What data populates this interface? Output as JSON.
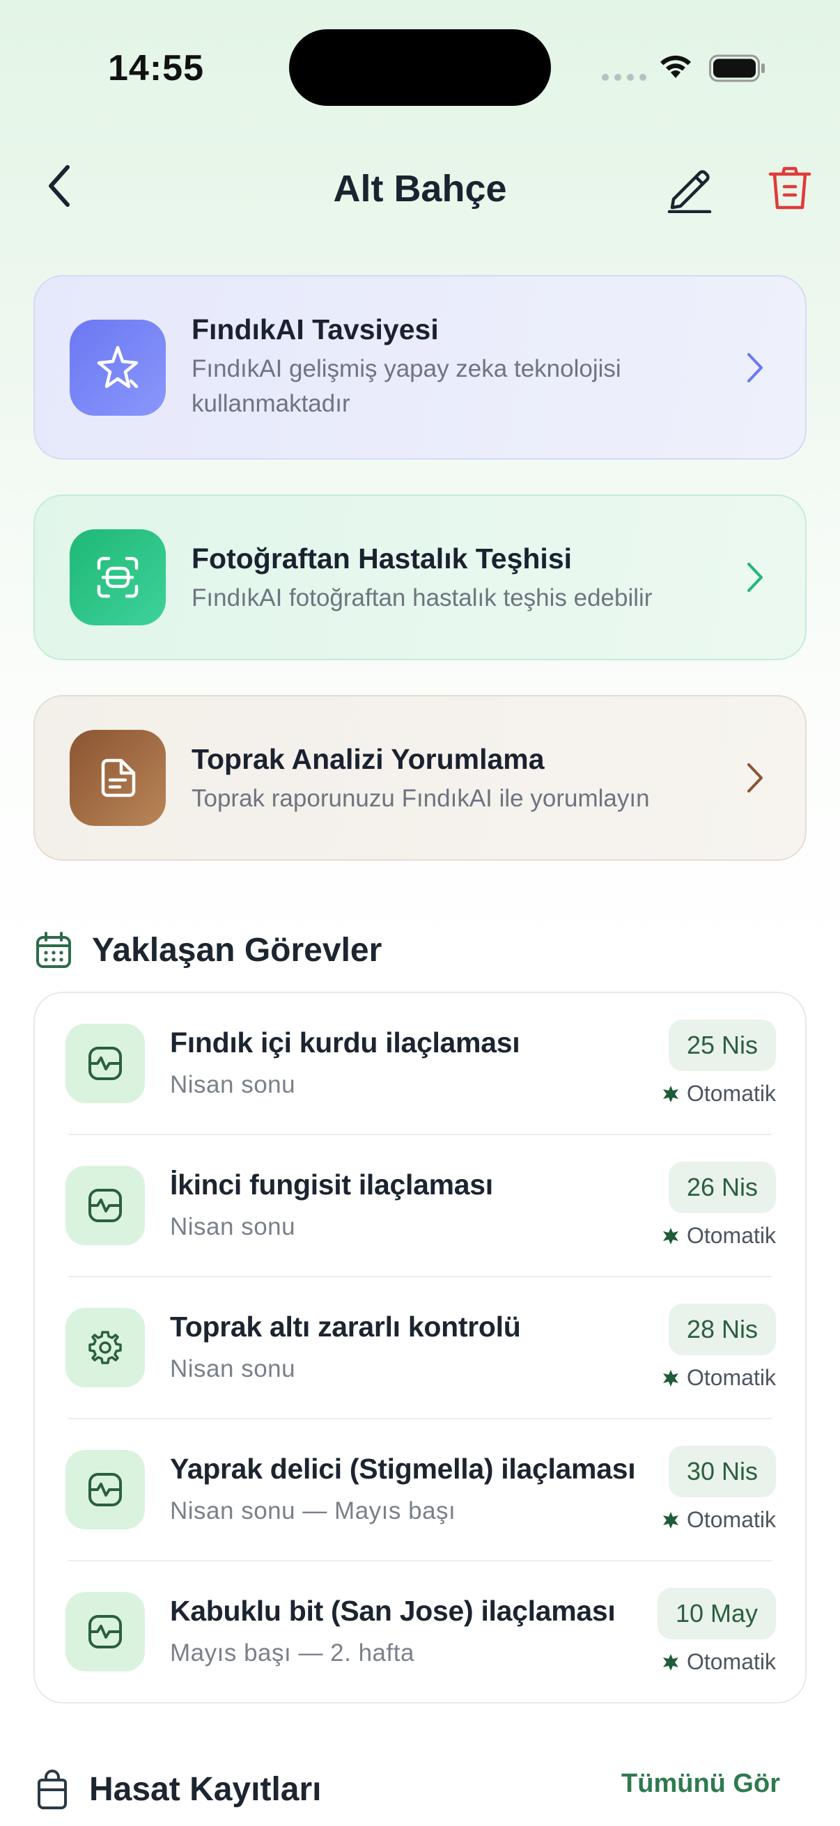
{
  "status": {
    "time": "14:55"
  },
  "header": {
    "title": "Alt Bahçe"
  },
  "cards": [
    {
      "title": "FındıkAI Tavsiyesi",
      "subtitle": "FındıkAI gelişmiş yapay zeka teknolojisi kullanmaktadır",
      "icon": "sparkle-icon",
      "color": "#6b78f2"
    },
    {
      "title": "Fotoğraftan Hastalık Teşhisi",
      "subtitle": "FındıkAI fotoğraftan hastalık teşhis edebilir",
      "icon": "scan-icon",
      "color": "#1fb876"
    },
    {
      "title": "Toprak Analizi Yorumlama",
      "subtitle": "Toprak raporunuzu FındıkAI ile yorumlayın",
      "icon": "document-icon",
      "color": "#8b5532"
    }
  ],
  "tasks_section": {
    "title": "Yaklaşan Görevler"
  },
  "tasks": [
    {
      "title": "Fındık içi kurdu ilaçlaması",
      "period": "Nisan sonu",
      "date": "25 Nis",
      "tag": "Otomatik",
      "icon": "activity-icon"
    },
    {
      "title": "İkinci fungisit ilaçlaması",
      "period": "Nisan sonu",
      "date": "26 Nis",
      "tag": "Otomatik",
      "icon": "activity-icon"
    },
    {
      "title": "Toprak altı zararlı kontrolü",
      "period": "Nisan sonu",
      "date": "28 Nis",
      "tag": "Otomatik",
      "icon": "gear-icon"
    },
    {
      "title": "Yaprak delici (Stigmella) ilaçlaması",
      "period": "Nisan sonu — Mayıs başı",
      "date": "30 Nis",
      "tag": "Otomatik",
      "icon": "activity-icon"
    },
    {
      "title": "Kabuklu bit (San Jose) ilaçlaması",
      "period": "Mayıs başı — 2. hafta",
      "date": "10 May",
      "tag": "Otomatik",
      "icon": "activity-icon"
    }
  ],
  "harvest_section": {
    "title": "Hasat Kayıtları",
    "see_all": "Tümünü Gör"
  },
  "colors": {
    "accent_green": "#2e7a4f",
    "danger": "#e03a3a",
    "ai_purple": "#6b78f2"
  }
}
